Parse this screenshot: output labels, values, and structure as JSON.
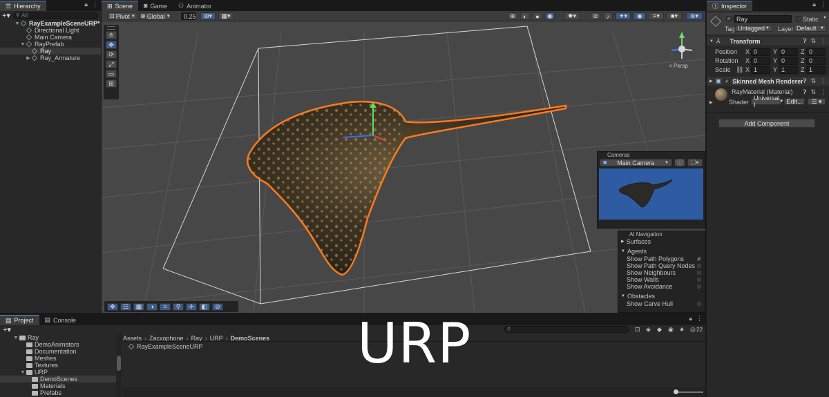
{
  "hierarchy": {
    "tab": "Hierarchy",
    "search_placeholder": "All",
    "items": [
      {
        "label": "RayExampleSceneURP*"
      },
      {
        "label": "Directional Light"
      },
      {
        "label": "Main Camera"
      },
      {
        "label": "RayPrefab"
      },
      {
        "label": "Ray"
      },
      {
        "label": "Ray_Armature"
      }
    ]
  },
  "scene_tabs": [
    {
      "label": "Scene"
    },
    {
      "label": "Game"
    },
    {
      "label": "Animator"
    }
  ],
  "scene_toolbar": {
    "pivot": "Pivot",
    "global": "Global",
    "snap": "0.25",
    "persp": "< Persp"
  },
  "cameras_overlay": {
    "title": "Cameras",
    "selected": "Main Camera"
  },
  "ai_navigation": {
    "title": "AI Navigation",
    "surfaces": "Surfaces",
    "agents": "Agents",
    "obstacles": "Obstacles",
    "options": [
      {
        "label": "Show Path Polygons",
        "checked": true
      },
      {
        "label": "Show Path Query Nodes",
        "checked": false
      },
      {
        "label": "Show Neighbours",
        "checked": false
      },
      {
        "label": "Show Walls",
        "checked": false
      },
      {
        "label": "Show Avoidance",
        "checked": false
      }
    ],
    "obstacle_option": "Show Carve Hull"
  },
  "inspector": {
    "tab": "Inspector",
    "object_name": "Ray",
    "static_label": "Static",
    "tag_label": "Tag",
    "tag_value": "Untagged",
    "layer_label": "Layer",
    "layer_value": "Default",
    "transform": {
      "title": "Transform",
      "position_label": "Position",
      "rotation_label": "Rotation",
      "scale_label": "Scale",
      "position": {
        "x": "0",
        "y": "0",
        "z": "0"
      },
      "rotation": {
        "x": "0",
        "y": "0",
        "z": "0"
      },
      "scale": {
        "x": "1",
        "y": "1",
        "z": "1"
      }
    },
    "renderer": {
      "title": "Skinned Mesh Renderer",
      "material": "RayMaterial (Material)",
      "shader_label": "Shader",
      "shader_value": "Universal I",
      "edit_label": "Edit..."
    },
    "add_component": "Add Component"
  },
  "project": {
    "tabs": [
      {
        "label": "Project"
      },
      {
        "label": "Console"
      }
    ],
    "tree": [
      {
        "label": "Ray"
      },
      {
        "label": "DemoAnimators"
      },
      {
        "label": "Documentation"
      },
      {
        "label": "Meshes"
      },
      {
        "label": "Textures"
      },
      {
        "label": "URP"
      },
      {
        "label": "DemoScenes"
      },
      {
        "label": "Materials"
      },
      {
        "label": "Prefabs"
      }
    ],
    "breadcrumb": [
      "Assets",
      "Zacxophone",
      "Ray",
      "URP",
      "DemoScenes"
    ],
    "files": [
      {
        "label": "RayExampleSceneURP"
      }
    ],
    "count": "22"
  },
  "overlay_title": "URP"
}
